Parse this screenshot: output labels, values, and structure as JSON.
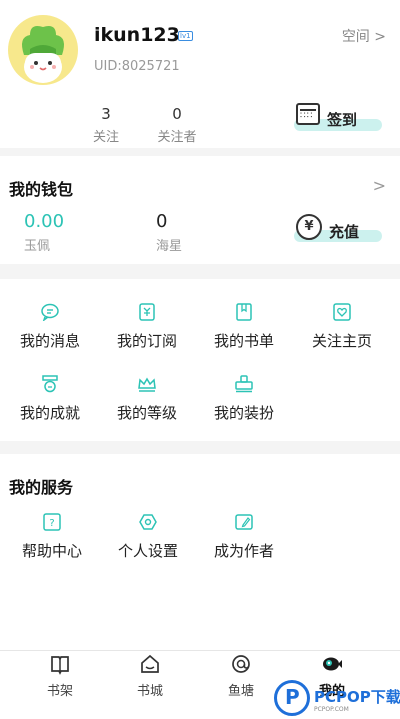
{
  "colors": {
    "accent": "#2cc3b5",
    "highlight": "#ccf1ee",
    "text": "#222222",
    "muted": "#999999",
    "brand_watermark": "#1e6fd9"
  },
  "profile": {
    "username": "ikun123",
    "level_badge": "lv1",
    "uid": "UID:8025721",
    "space_link": "空间 >",
    "avatar_icon": "cabbage-character-icon",
    "stats": [
      {
        "value": "3",
        "label": "关注"
      },
      {
        "value": "0",
        "label": "关注者"
      }
    ],
    "checkin": {
      "label": "签到",
      "icon": "calendar-icon"
    }
  },
  "wallet": {
    "title": "我的钱包",
    "chevron": ">",
    "items": [
      {
        "value": "0.00",
        "label": "玉佩",
        "color": "#2cc3b5"
      },
      {
        "value": "0",
        "label": "海星",
        "color": "#222222"
      }
    ],
    "recharge": {
      "label": "充值",
      "icon_text": "¥",
      "icon": "yen-coin-icon"
    }
  },
  "features": [
    {
      "label": "我的消息",
      "icon": "message-icon"
    },
    {
      "label": "我的订阅",
      "icon": "subscription-icon"
    },
    {
      "label": "我的书单",
      "icon": "booklist-icon"
    },
    {
      "label": "关注主页",
      "icon": "follow-heart-icon"
    },
    {
      "label": "我的成就",
      "icon": "medal-icon"
    },
    {
      "label": "我的等级",
      "icon": "crown-icon"
    },
    {
      "label": "我的装扮",
      "icon": "dressup-icon"
    }
  ],
  "services": {
    "title": "我的服务",
    "items": [
      {
        "label": "帮助中心",
        "icon": "help-icon"
      },
      {
        "label": "个人设置",
        "icon": "settings-icon"
      },
      {
        "label": "成为作者",
        "icon": "author-icon"
      }
    ]
  },
  "tabbar": [
    {
      "label": "书架",
      "icon": "bookshelf-icon",
      "active": false
    },
    {
      "label": "书城",
      "icon": "bookstore-icon",
      "active": false
    },
    {
      "label": "鱼塘",
      "icon": "fishpond-icon",
      "active": false
    },
    {
      "label": "我的",
      "icon": "mine-fish-icon",
      "active": true
    }
  ],
  "watermark": {
    "text": "PCPOP下载",
    "sub": "PCPOP.COM"
  }
}
